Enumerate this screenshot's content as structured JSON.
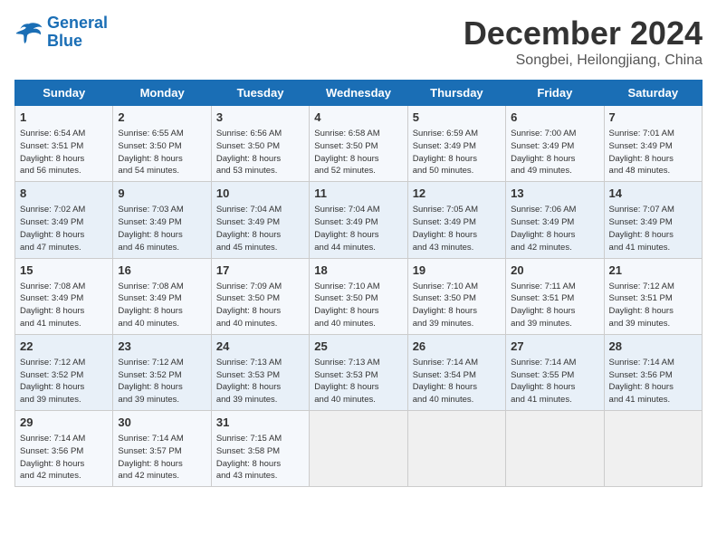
{
  "logo": {
    "line1": "General",
    "line2": "Blue"
  },
  "title": "December 2024",
  "subtitle": "Songbei, Heilongjiang, China",
  "days_of_week": [
    "Sunday",
    "Monday",
    "Tuesday",
    "Wednesday",
    "Thursday",
    "Friday",
    "Saturday"
  ],
  "weeks": [
    [
      {
        "day": "1",
        "info": "Sunrise: 6:54 AM\nSunset: 3:51 PM\nDaylight: 8 hours\nand 56 minutes."
      },
      {
        "day": "2",
        "info": "Sunrise: 6:55 AM\nSunset: 3:50 PM\nDaylight: 8 hours\nand 54 minutes."
      },
      {
        "day": "3",
        "info": "Sunrise: 6:56 AM\nSunset: 3:50 PM\nDaylight: 8 hours\nand 53 minutes."
      },
      {
        "day": "4",
        "info": "Sunrise: 6:58 AM\nSunset: 3:50 PM\nDaylight: 8 hours\nand 52 minutes."
      },
      {
        "day": "5",
        "info": "Sunrise: 6:59 AM\nSunset: 3:49 PM\nDaylight: 8 hours\nand 50 minutes."
      },
      {
        "day": "6",
        "info": "Sunrise: 7:00 AM\nSunset: 3:49 PM\nDaylight: 8 hours\nand 49 minutes."
      },
      {
        "day": "7",
        "info": "Sunrise: 7:01 AM\nSunset: 3:49 PM\nDaylight: 8 hours\nand 48 minutes."
      }
    ],
    [
      {
        "day": "8",
        "info": "Sunrise: 7:02 AM\nSunset: 3:49 PM\nDaylight: 8 hours\nand 47 minutes."
      },
      {
        "day": "9",
        "info": "Sunrise: 7:03 AM\nSunset: 3:49 PM\nDaylight: 8 hours\nand 46 minutes."
      },
      {
        "day": "10",
        "info": "Sunrise: 7:04 AM\nSunset: 3:49 PM\nDaylight: 8 hours\nand 45 minutes."
      },
      {
        "day": "11",
        "info": "Sunrise: 7:04 AM\nSunset: 3:49 PM\nDaylight: 8 hours\nand 44 minutes."
      },
      {
        "day": "12",
        "info": "Sunrise: 7:05 AM\nSunset: 3:49 PM\nDaylight: 8 hours\nand 43 minutes."
      },
      {
        "day": "13",
        "info": "Sunrise: 7:06 AM\nSunset: 3:49 PM\nDaylight: 8 hours\nand 42 minutes."
      },
      {
        "day": "14",
        "info": "Sunrise: 7:07 AM\nSunset: 3:49 PM\nDaylight: 8 hours\nand 41 minutes."
      }
    ],
    [
      {
        "day": "15",
        "info": "Sunrise: 7:08 AM\nSunset: 3:49 PM\nDaylight: 8 hours\nand 41 minutes."
      },
      {
        "day": "16",
        "info": "Sunrise: 7:08 AM\nSunset: 3:49 PM\nDaylight: 8 hours\nand 40 minutes."
      },
      {
        "day": "17",
        "info": "Sunrise: 7:09 AM\nSunset: 3:50 PM\nDaylight: 8 hours\nand 40 minutes."
      },
      {
        "day": "18",
        "info": "Sunrise: 7:10 AM\nSunset: 3:50 PM\nDaylight: 8 hours\nand 40 minutes."
      },
      {
        "day": "19",
        "info": "Sunrise: 7:10 AM\nSunset: 3:50 PM\nDaylight: 8 hours\nand 39 minutes."
      },
      {
        "day": "20",
        "info": "Sunrise: 7:11 AM\nSunset: 3:51 PM\nDaylight: 8 hours\nand 39 minutes."
      },
      {
        "day": "21",
        "info": "Sunrise: 7:12 AM\nSunset: 3:51 PM\nDaylight: 8 hours\nand 39 minutes."
      }
    ],
    [
      {
        "day": "22",
        "info": "Sunrise: 7:12 AM\nSunset: 3:52 PM\nDaylight: 8 hours\nand 39 minutes."
      },
      {
        "day": "23",
        "info": "Sunrise: 7:12 AM\nSunset: 3:52 PM\nDaylight: 8 hours\nand 39 minutes."
      },
      {
        "day": "24",
        "info": "Sunrise: 7:13 AM\nSunset: 3:53 PM\nDaylight: 8 hours\nand 39 minutes."
      },
      {
        "day": "25",
        "info": "Sunrise: 7:13 AM\nSunset: 3:53 PM\nDaylight: 8 hours\nand 40 minutes."
      },
      {
        "day": "26",
        "info": "Sunrise: 7:14 AM\nSunset: 3:54 PM\nDaylight: 8 hours\nand 40 minutes."
      },
      {
        "day": "27",
        "info": "Sunrise: 7:14 AM\nSunset: 3:55 PM\nDaylight: 8 hours\nand 41 minutes."
      },
      {
        "day": "28",
        "info": "Sunrise: 7:14 AM\nSunset: 3:56 PM\nDaylight: 8 hours\nand 41 minutes."
      }
    ],
    [
      {
        "day": "29",
        "info": "Sunrise: 7:14 AM\nSunset: 3:56 PM\nDaylight: 8 hours\nand 42 minutes."
      },
      {
        "day": "30",
        "info": "Sunrise: 7:14 AM\nSunset: 3:57 PM\nDaylight: 8 hours\nand 42 minutes."
      },
      {
        "day": "31",
        "info": "Sunrise: 7:15 AM\nSunset: 3:58 PM\nDaylight: 8 hours\nand 43 minutes."
      },
      {
        "day": "",
        "info": ""
      },
      {
        "day": "",
        "info": ""
      },
      {
        "day": "",
        "info": ""
      },
      {
        "day": "",
        "info": ""
      }
    ]
  ]
}
